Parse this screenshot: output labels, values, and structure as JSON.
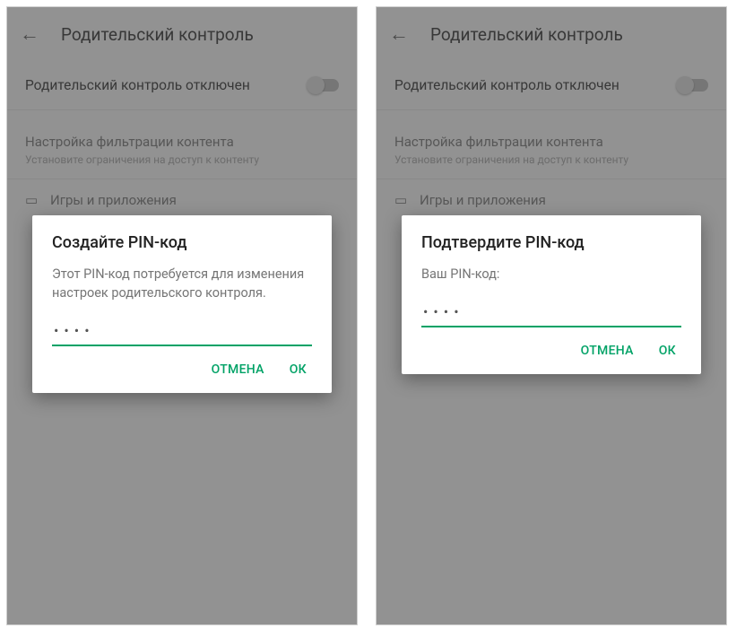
{
  "colors": {
    "accent": "#00a266"
  },
  "toolbar": {
    "title": "Родительский контроль"
  },
  "settings": {
    "toggle_label": "Родительский контроль отключен",
    "filter_section_title": "Настройка фильтрации контента",
    "filter_section_sub": "Установите ограничения на доступ к контенту",
    "apps_item_label": "Игры и приложения"
  },
  "dialog_left": {
    "title": "Создайте PIN-код",
    "message": "Этот PIN-код потребуется для изменения настроек родительского контроля.",
    "pin_value": "••••",
    "cancel": "ОТМЕНА",
    "ok": "ОК"
  },
  "dialog_right": {
    "title": "Подтвердите PIN-код",
    "message": "Ваш PIN-код:",
    "pin_value": "••••",
    "cancel": "ОТМЕНА",
    "ok": "ОК"
  }
}
